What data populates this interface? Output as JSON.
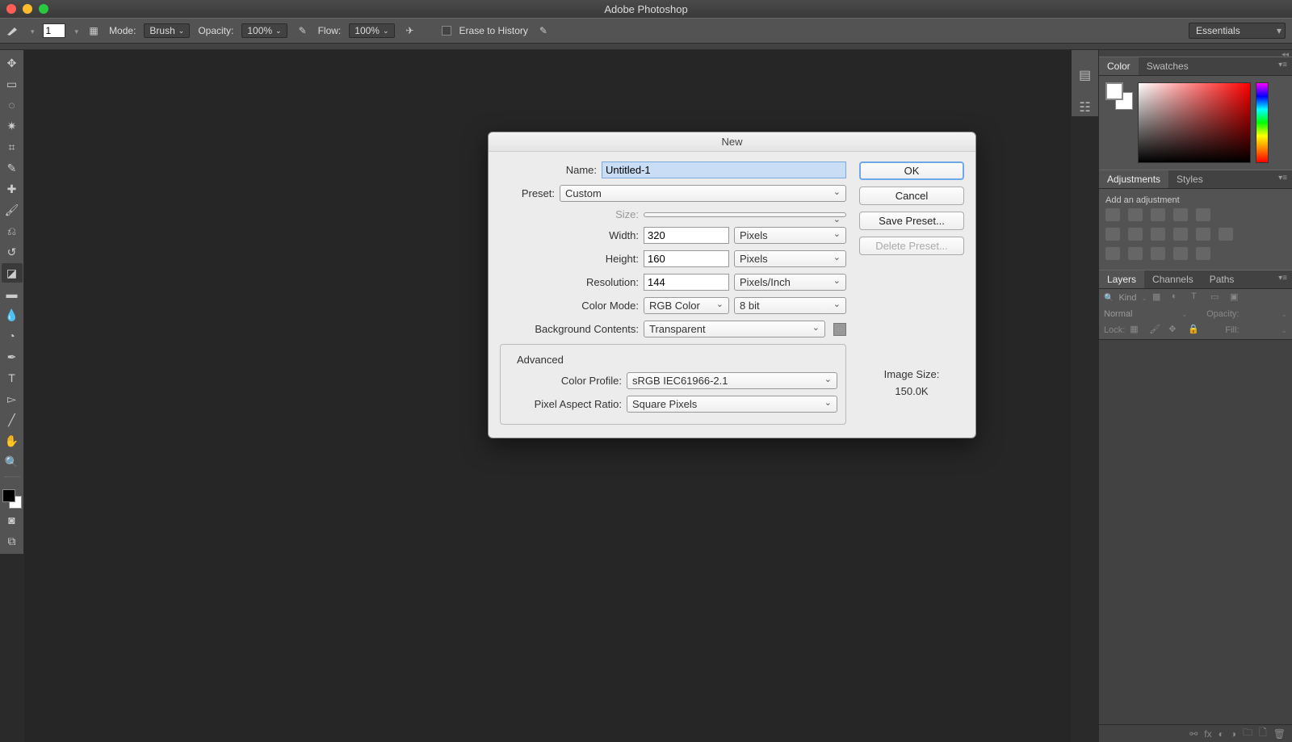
{
  "app_title": "Adobe Photoshop",
  "workspace_selector": "Essentials",
  "options_bar": {
    "size_value": "1",
    "mode_label": "Mode:",
    "mode_value": "Brush",
    "opacity_label": "Opacity:",
    "opacity_value": "100%",
    "flow_label": "Flow:",
    "flow_value": "100%",
    "erase_history_label": "Erase to History"
  },
  "panels": {
    "color_tab": "Color",
    "swatches_tab": "Swatches",
    "adjustments_tab": "Adjustments",
    "styles_tab": "Styles",
    "add_adjustment": "Add an adjustment",
    "layers_tab": "Layers",
    "channels_tab": "Channels",
    "paths_tab": "Paths",
    "kind_label": "Kind",
    "blend_mode": "Normal",
    "opacity_panel_label": "Opacity:",
    "lock_label": "Lock:",
    "fill_label": "Fill:"
  },
  "dialog": {
    "title": "New",
    "labels": {
      "name": "Name:",
      "preset": "Preset:",
      "size": "Size:",
      "width": "Width:",
      "height": "Height:",
      "resolution": "Resolution:",
      "color_mode": "Color Mode:",
      "bg_contents": "Background Contents:",
      "advanced": "Advanced",
      "color_profile": "Color Profile:",
      "pixel_aspect": "Pixel Aspect Ratio:",
      "image_size": "Image Size:"
    },
    "values": {
      "name": "Untitled-1",
      "preset": "Custom",
      "size": "",
      "width": "320",
      "width_unit": "Pixels",
      "height": "160",
      "height_unit": "Pixels",
      "resolution": "144",
      "resolution_unit": "Pixels/Inch",
      "color_mode": "RGB Color",
      "bit_depth": "8 bit",
      "bg_contents": "Transparent",
      "color_profile": "sRGB IEC61966-2.1",
      "pixel_aspect": "Square Pixels",
      "image_size_value": "150.0K"
    },
    "buttons": {
      "ok": "OK",
      "cancel": "Cancel",
      "save_preset": "Save Preset...",
      "delete_preset": "Delete Preset..."
    }
  }
}
